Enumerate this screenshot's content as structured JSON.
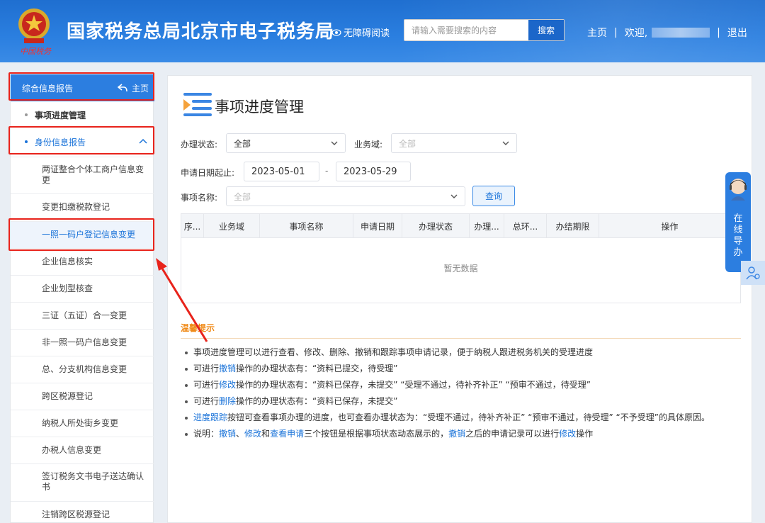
{
  "header": {
    "site_title": "国家税务总局北京市电子税务局",
    "emblem_text": "中国税务",
    "accessibility": "无障碍阅读",
    "search_placeholder": "请输入需要搜索的内容",
    "search_button": "搜索",
    "nav": {
      "home": "主页",
      "sep1": "|",
      "welcome": "欢迎,",
      "sep2": "|",
      "logout": "退出"
    }
  },
  "sidebar": {
    "header_label": "综合信息报告",
    "home_label": "主页",
    "groups": [
      {
        "label": "事项进度管理"
      },
      {
        "label": "身份信息报告"
      }
    ],
    "items": [
      {
        "label": "两证整合个体工商户信息变更"
      },
      {
        "label": "变更扣缴税款登记"
      },
      {
        "label": "一照一码户登记信息变更"
      },
      {
        "label": "企业信息核实"
      },
      {
        "label": "企业划型核查"
      },
      {
        "label": "三证（五证）合一变更"
      },
      {
        "label": "非一照一码户信息变更"
      },
      {
        "label": "总、分支机构信息变更"
      },
      {
        "label": "跨区税源登记"
      },
      {
        "label": "纳税人所处街乡变更"
      },
      {
        "label": "办税人信息变更"
      },
      {
        "label": "签订税务文书电子送达确认书"
      },
      {
        "label": "注销跨区税源登记"
      }
    ]
  },
  "main": {
    "title": "事项进度管理",
    "filters": {
      "status_label": "办理状态:",
      "status_value": "全部",
      "domain_label": "业务域:",
      "domain_placeholder": "全部",
      "date_label": "申请日期起止:",
      "date_start": "2023-05-01",
      "date_sep": "-",
      "date_end": "2023-05-29",
      "name_label": "事项名称:",
      "name_placeholder": "全部",
      "query_button": "查询"
    },
    "table": {
      "columns": [
        "序...",
        "业务域",
        "事项名称",
        "申请日期",
        "办理状态",
        "办理...",
        "总环...",
        "办结期限",
        "操作"
      ],
      "empty_text": "暂无数据"
    },
    "tips": {
      "title": "温馨提示",
      "t1": "事项进度管理可以进行查看、修改、删除、撤销和跟踪事项申请记录，便于纳税人跟进税务机关的受理进度",
      "t2_a": "可进行",
      "t2_link": "撤销",
      "t2_b": "操作的办理状态有：“资料已提交，待受理”",
      "t3_a": "可进行",
      "t3_link": "修改",
      "t3_b": "操作的办理状态有：“资料已保存，未提交” “受理不通过，待补齐补正” “预审不通过，待受理”",
      "t4_a": "可进行",
      "t4_link": "删除",
      "t4_b": "操作的办理状态有：“资料已保存，未提交”",
      "t5_link": "进度跟踪",
      "t5_b": "按钮可查看事项办理的进度，也可查看办理状态为：“受理不通过，待补齐补正” “预审不通过，待受理” “不予受理”的具体原因。",
      "t6_a": "说明：",
      "t6_l1": "撤销",
      "t6_s1": "、",
      "t6_l2": "修改",
      "t6_s2": "和",
      "t6_l3": "查看申请",
      "t6_b": "三个按钮是根据事项状态动态展示的，",
      "t6_l4": "撤销",
      "t6_c": "之后的申请记录可以进行",
      "t6_l5": "修改",
      "t6_d": "操作"
    }
  },
  "float": {
    "service_text": "在线导办"
  },
  "colors": {
    "brand": "#2c7ee0",
    "link": "#1a73d9",
    "highlight": "#e8231b",
    "tips": "#f08a17"
  }
}
